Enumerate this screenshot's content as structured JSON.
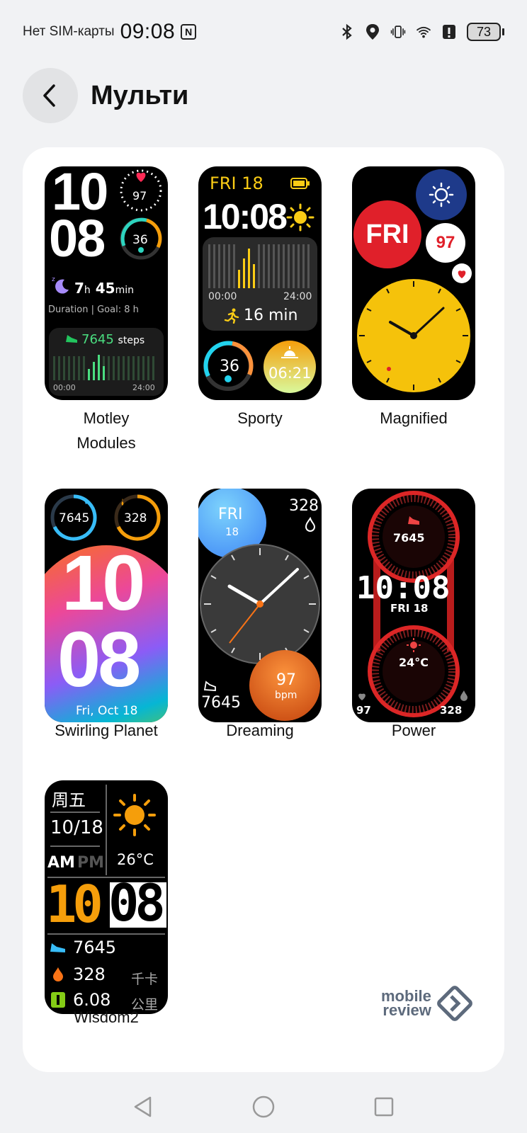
{
  "status_bar": {
    "carrier": "Нет SIM-карты",
    "time": "09:08",
    "nfc_label": "N",
    "battery_level": "73",
    "icons": [
      "bluetooth-icon",
      "location-icon",
      "vibrate-icon",
      "wifi-icon",
      "alert-icon",
      "battery-icon"
    ]
  },
  "header": {
    "title": "Мульти",
    "back_icon": "chevron-left-icon"
  },
  "faces": [
    {
      "label": "Motley Modules",
      "hour": "10",
      "minute": "08",
      "heart_rate": "97",
      "stress": "36",
      "sleep_hours": "7",
      "sleep_h_unit": "h",
      "sleep_minutes": "45",
      "sleep_min_unit": "min",
      "duration_goal": "Duration | Goal: 8 h",
      "steps": "7645",
      "steps_unit": "steps",
      "time_start": "00:00",
      "time_end": "24:00"
    },
    {
      "label": "Sporty",
      "date": "FRI 18",
      "time": "10:08",
      "chart_start": "00:00",
      "chart_end": "24:00",
      "activity": "16 min",
      "stress": "36",
      "sunrise": "06:21"
    },
    {
      "label": "Magnified",
      "day": "FRI",
      "heart_rate": "97"
    },
    {
      "label": "Swirling Planet",
      "steps": "7645",
      "calories": "328",
      "hour": "10",
      "minute": "08",
      "date": "Fri, Oct 18"
    },
    {
      "label": "Dreaming",
      "day": "FRI",
      "date": "18",
      "calories": "328",
      "heart_rate": "97",
      "heart_unit": "bpm",
      "steps": "7645"
    },
    {
      "label": "Power",
      "steps": "7645",
      "time": "10:08",
      "date": "FRI 18",
      "temperature": "24°C",
      "heart_rate": "97",
      "calories": "328"
    },
    {
      "label": "Wisdom2",
      "weekday": "周五",
      "date": "10/18",
      "am": "AM",
      "pm": "PM",
      "temperature": "26°C",
      "hour": "10",
      "minute": "08",
      "steps": "7645",
      "calories": "328",
      "calories_unit": "千卡",
      "distance": "6.08",
      "distance_unit": "公里"
    }
  ],
  "watermark": {
    "line1": "mobile",
    "line2": "review"
  },
  "nav": {
    "back": "nav-back-icon",
    "home": "nav-home-icon",
    "recents": "nav-recents-icon"
  },
  "colors": {
    "background": "#f1f2f4",
    "card": "#ffffff",
    "accent_yellow": "#f5c20b",
    "accent_red": "#e0202a"
  }
}
